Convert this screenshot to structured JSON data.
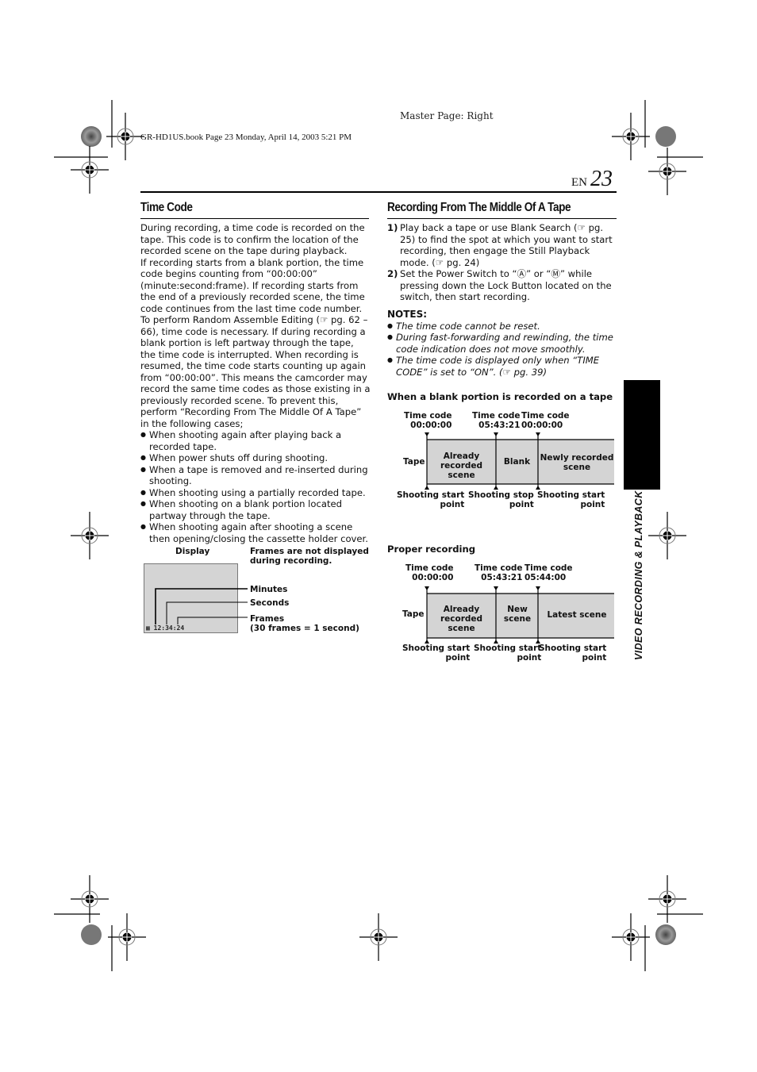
{
  "header": {
    "master_page": "Master Page: Right",
    "book_line": "GR-HD1US.book  Page 23  Monday, April 14, 2003  5:21 PM",
    "lang": "EN",
    "page_number": "23"
  },
  "side_tab": {
    "label": "VIDEO RECORDING & PLAYBACK"
  },
  "time_code": {
    "title": "Time Code",
    "paragraphs": [
      "During recording, a time code is recorded on the tape. This code is to confirm the location of the recorded scene on the tape during playback.",
      "If recording starts from a blank portion, the time code begins counting from “00:00:00” (minute:second:frame). If recording starts from the end of a previously recorded scene, the time code continues from the last time code number.",
      "To perform Random Assemble Editing (☞ pg. 62 – 66), time code is necessary. If during recording a blank portion is left partway through the tape, the time code is interrupted. When recording is resumed, the time code starts counting up again from “00:00:00”. This means the camcorder may record the same time codes as those existing in a previously recorded scene. To prevent this, perform “Recording From The Middle Of A Tape” in the following cases;"
    ],
    "bullets": [
      "When shooting again after playing back a recorded tape.",
      "When power shuts off during shooting.",
      "When a tape is removed and re-inserted during shooting.",
      "When shooting using a partially recorded tape.",
      "When shooting on a blank portion located partway through the tape.",
      "When shooting again after shooting a scene then opening/closing the cassette holder cover."
    ],
    "display_figure": {
      "display_label": "Display",
      "frames_note": "Frames are not displayed during recording.",
      "readout": "12:34:24",
      "minutes_label": "Minutes",
      "seconds_label": "Seconds",
      "frames_label": "Frames",
      "frames_sub": "(30 frames = 1 second)"
    }
  },
  "middle_of_tape": {
    "title": "Recording From The Middle Of A Tape",
    "steps": [
      {
        "n": "1)",
        "text": "Play back a tape or use Blank Search (☞ pg. 25) to find the spot at which you want to start recording, then engage the Still Playback mode. (☞ pg. 24)"
      },
      {
        "n": "2)",
        "text": "Set the Power Switch to “Ⓐ” or “Ⓜ” while pressing down the Lock Button located on the switch, then start recording."
      }
    ],
    "notes_title": "NOTES:",
    "notes": [
      "The time code cannot be reset.",
      "During fast-forwarding and rewinding, the time code indication does not move smoothly.",
      "The time code is displayed only when “TIME CODE” is set to “ON”. (☞ pg. 39)"
    ],
    "diagram1": {
      "title": "When a blank portion is recorded on a tape",
      "tape_label": "Tape",
      "timecodes": [
        {
          "label": "Time code",
          "value": "00:00:00"
        },
        {
          "label": "Time code",
          "value": "05:43:21"
        },
        {
          "label": "Time code",
          "value": "00:00:00"
        }
      ],
      "segments": [
        "Already recorded scene",
        "Blank",
        "Newly recorded scene"
      ],
      "points": [
        {
          "line1": "Shooting start",
          "line2": "point"
        },
        {
          "line1": "Shooting stop",
          "line2": "point"
        },
        {
          "line1": "Shooting start",
          "line2": "point"
        }
      ]
    },
    "diagram2": {
      "title": "Proper recording",
      "tape_label": "Tape",
      "timecodes": [
        {
          "label": "Time code",
          "value": "00:00:00"
        },
        {
          "label": "Time code",
          "value": "05:43:21"
        },
        {
          "label": "Time code",
          "value": "05:44:00"
        }
      ],
      "segments": [
        "Already recorded scene",
        "New scene",
        "Latest scene"
      ],
      "points": [
        {
          "line1": "Shooting start",
          "line2": "point"
        },
        {
          "line1": "Shooting start",
          "line2": "point"
        },
        {
          "line1": "Shooting start",
          "line2": "point"
        }
      ]
    }
  },
  "colors": {
    "tape_fill": "#d4d4d4",
    "ink": "#000000"
  }
}
